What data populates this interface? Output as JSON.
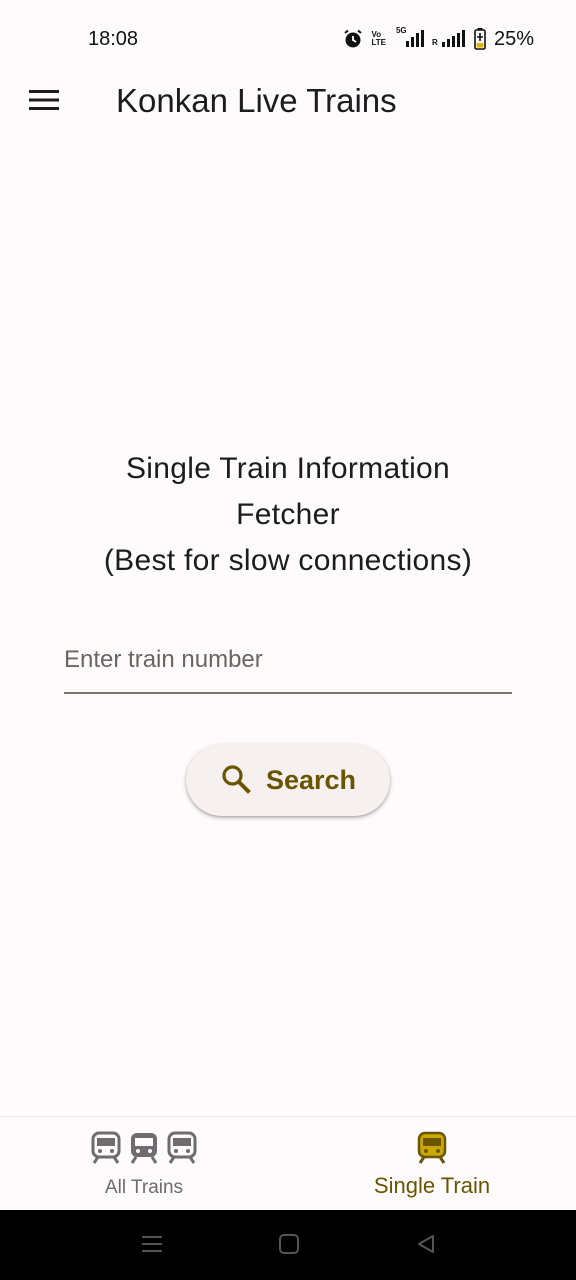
{
  "status_bar": {
    "time": "18:08",
    "battery_percent": "25%",
    "volte_top": "Vo",
    "volte_bottom": "LTE",
    "network_5g": "5G",
    "roaming": "R",
    "icons": [
      "alarm-icon",
      "volte-icon",
      "5g-signal-icon",
      "signal-icon",
      "battery-charging-icon"
    ]
  },
  "app_bar": {
    "title": "Konkan Live Trains",
    "menu_icon": "menu-icon"
  },
  "main": {
    "heading_line1": "Single Train Information",
    "heading_line2": "Fetcher",
    "heading_line3": "(Best for slow connections)",
    "train_number_field": {
      "placeholder": "Enter train number",
      "value": ""
    },
    "search_button": {
      "label": "Search",
      "icon": "search-icon"
    }
  },
  "bottom_nav": {
    "items": [
      {
        "label": "All Trains",
        "icon": "train-icon",
        "active": false
      },
      {
        "label": "Single Train",
        "icon": "train-icon",
        "active": true
      }
    ]
  },
  "colors": {
    "accent": "#6a5400",
    "background": "#fefbfd",
    "button_bg": "#f6f1ee",
    "inactive": "#6f6b6e"
  }
}
